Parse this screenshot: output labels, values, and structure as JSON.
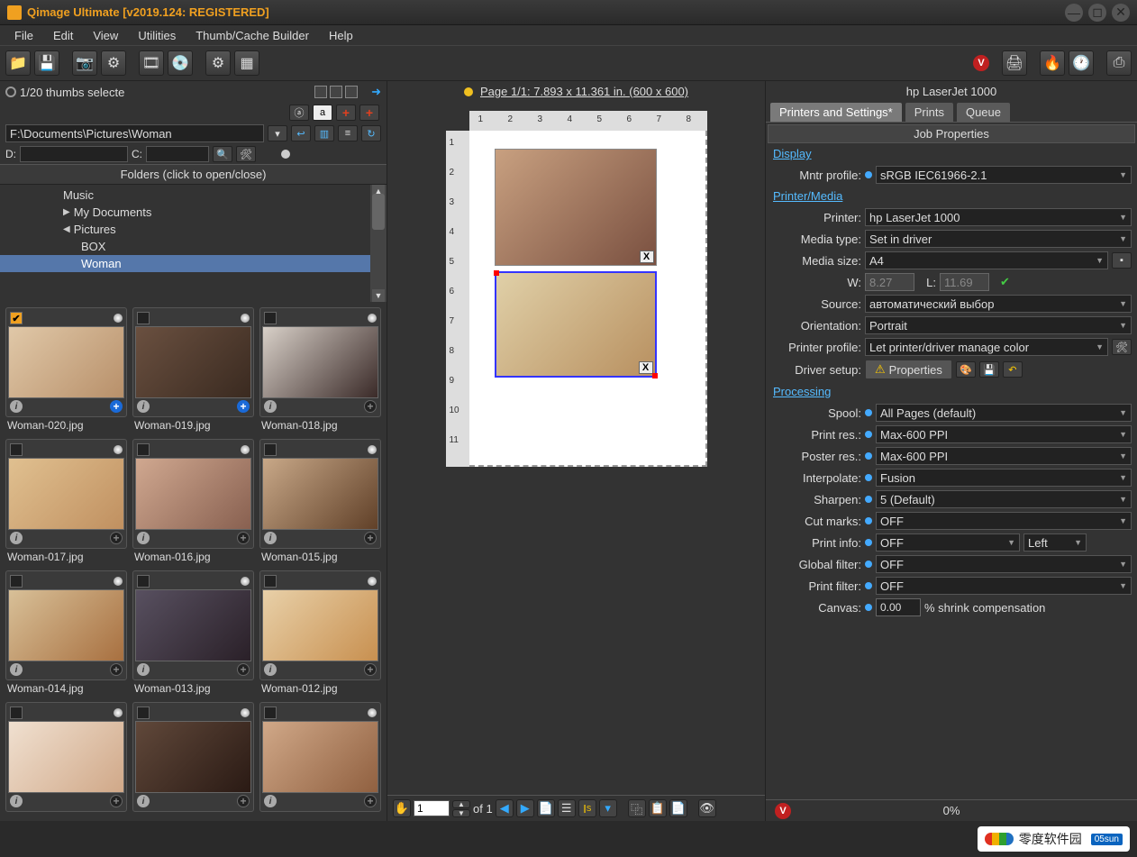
{
  "title": "Qimage Ultimate [v2019.124: REGISTERED]",
  "menus": [
    "File",
    "Edit",
    "View",
    "Utilities",
    "Thumb/Cache Builder",
    "Help"
  ],
  "thumbs_header": "1/20 thumbs selecte",
  "path": "F:\\Documents\\Pictures\\Woman",
  "drive_d_label": "D:",
  "drive_c_label": "C:",
  "folder_title": "Folders (click to open/close)",
  "tree": [
    {
      "label": "Music",
      "level": 2,
      "expand": ""
    },
    {
      "label": "My Documents",
      "level": 2,
      "expand": "▶"
    },
    {
      "label": "Pictures",
      "level": 2,
      "expand": "◀"
    },
    {
      "label": "BOX",
      "level": 3,
      "expand": ""
    },
    {
      "label": "Woman",
      "level": 3,
      "expand": "",
      "sel": true
    }
  ],
  "thumbs": [
    {
      "name": "Woman-020.jpg",
      "checked": true,
      "blue": true,
      "grad": "#e0c8a8,#b8906a"
    },
    {
      "name": "Woman-019.jpg",
      "checked": false,
      "blue": true,
      "grad": "#6a5040,#3a2a20"
    },
    {
      "name": "Woman-018.jpg",
      "checked": false,
      "blue": false,
      "grad": "#d8d0c8,#3a2a28"
    },
    {
      "name": "Woman-017.jpg",
      "checked": false,
      "blue": false,
      "grad": "#e0c090,#c09060"
    },
    {
      "name": "Woman-016.jpg",
      "checked": false,
      "blue": false,
      "grad": "#d0a890,#886050"
    },
    {
      "name": "Woman-015.jpg",
      "checked": false,
      "blue": false,
      "grad": "#c8a888,#604028"
    },
    {
      "name": "Woman-014.jpg",
      "checked": false,
      "blue": false,
      "grad": "#d8c098,#a87040"
    },
    {
      "name": "Woman-013.jpg",
      "checked": false,
      "blue": false,
      "grad": "#585060,#2a2028"
    },
    {
      "name": "Woman-012.jpg",
      "checked": false,
      "blue": false,
      "grad": "#e8d0a8,#c89050"
    },
    {
      "name": "",
      "checked": false,
      "blue": false,
      "grad": "#f0e0d0,#d0a888"
    },
    {
      "name": "",
      "checked": false,
      "blue": false,
      "grad": "#60483a,#2a1a14"
    },
    {
      "name": "",
      "checked": false,
      "blue": false,
      "grad": "#d0a888,#906040"
    }
  ],
  "page_info": "Page 1/1: 7.893 x 11.361 in.  (600 x 600)",
  "ruler_h": [
    "1",
    "2",
    "3",
    "4",
    "5",
    "6",
    "7",
    "8"
  ],
  "ruler_v": [
    "1",
    "2",
    "3",
    "4",
    "5",
    "6",
    "7",
    "8",
    "9",
    "10",
    "11"
  ],
  "pagefoot": {
    "page": "1",
    "of": "of 1"
  },
  "printer_name": "hp LaserJet 1000",
  "tabs": [
    "Printers and Settings*",
    "Prints",
    "Queue"
  ],
  "job_header": "Job Properties",
  "sections": {
    "display": "Display",
    "printer_media": "Printer/Media",
    "processing": "Processing"
  },
  "props": {
    "mntr_profile_label": "Mntr profile:",
    "mntr_profile": "sRGB IEC61966-2.1",
    "printer_label": "Printer:",
    "printer": "hp LaserJet 1000",
    "media_type_label": "Media type:",
    "media_type": "Set in driver",
    "media_size_label": "Media size:",
    "media_size": "A4",
    "w_label": "W:",
    "w": "8.27",
    "l_label": "L:",
    "l": "11.69",
    "source_label": "Source:",
    "source": "автоматический выбор",
    "orientation_label": "Orientation:",
    "orientation": "Portrait",
    "printer_profile_label": "Printer profile:",
    "printer_profile": "Let printer/driver manage color",
    "driver_setup_label": "Driver setup:",
    "properties_btn": "Properties",
    "spool_label": "Spool:",
    "spool": "All Pages (default)",
    "print_res_label": "Print res.:",
    "print_res": "Max-600 PPI",
    "poster_res_label": "Poster res.:",
    "poster_res": "Max-600 PPI",
    "interpolate_label": "Interpolate:",
    "interpolate": "Fusion",
    "sharpen_label": "Sharpen:",
    "sharpen": "5 (Default)",
    "cut_marks_label": "Cut marks:",
    "cut_marks": "OFF",
    "print_info_label": "Print info:",
    "print_info": "OFF",
    "print_info_pos": "Left",
    "global_filter_label": "Global filter:",
    "global_filter": "OFF",
    "print_filter_label": "Print filter:",
    "print_filter": "OFF",
    "canvas_label": "Canvas:",
    "canvas": "0.00",
    "canvas_suffix": "% shrink compensation"
  },
  "status_pct": "0%",
  "watermark": {
    "text": "零度软件园",
    "tag": "05sun"
  }
}
